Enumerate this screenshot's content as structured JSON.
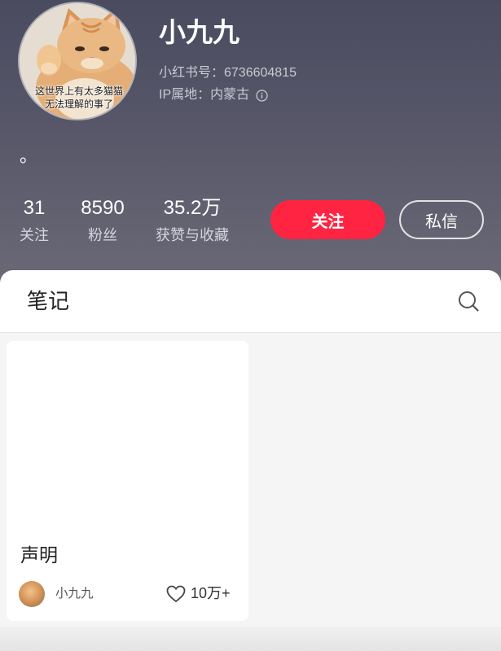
{
  "profile": {
    "name": "小九九",
    "account_id": "小红书号：6736604815",
    "ip_location": "IP属地：内蒙古",
    "bio": "。",
    "avatar_caption": [
      "这世界上有太多猫猫",
      "无法理解的事了"
    ]
  },
  "stats": [
    {
      "value": "31",
      "label": "关注"
    },
    {
      "value": "8590",
      "label": "粉丝"
    },
    {
      "value": "35.2万",
      "label": "获赞与收藏"
    }
  ],
  "actions": {
    "follow_label": "关注",
    "message_label": "私信"
  },
  "tabs": {
    "notes_label": "笔记"
  },
  "notes": [
    {
      "title": "声明",
      "author": "小九九",
      "likes": "10万+"
    }
  ],
  "icons": {
    "search": "search-icon",
    "info": "info-icon",
    "like": "heart-icon"
  },
  "colors": {
    "accent": "#ff2442",
    "header_top": "#4a4b5f",
    "header_bottom": "#6b6976",
    "feed_background": "#f5f5f5"
  }
}
